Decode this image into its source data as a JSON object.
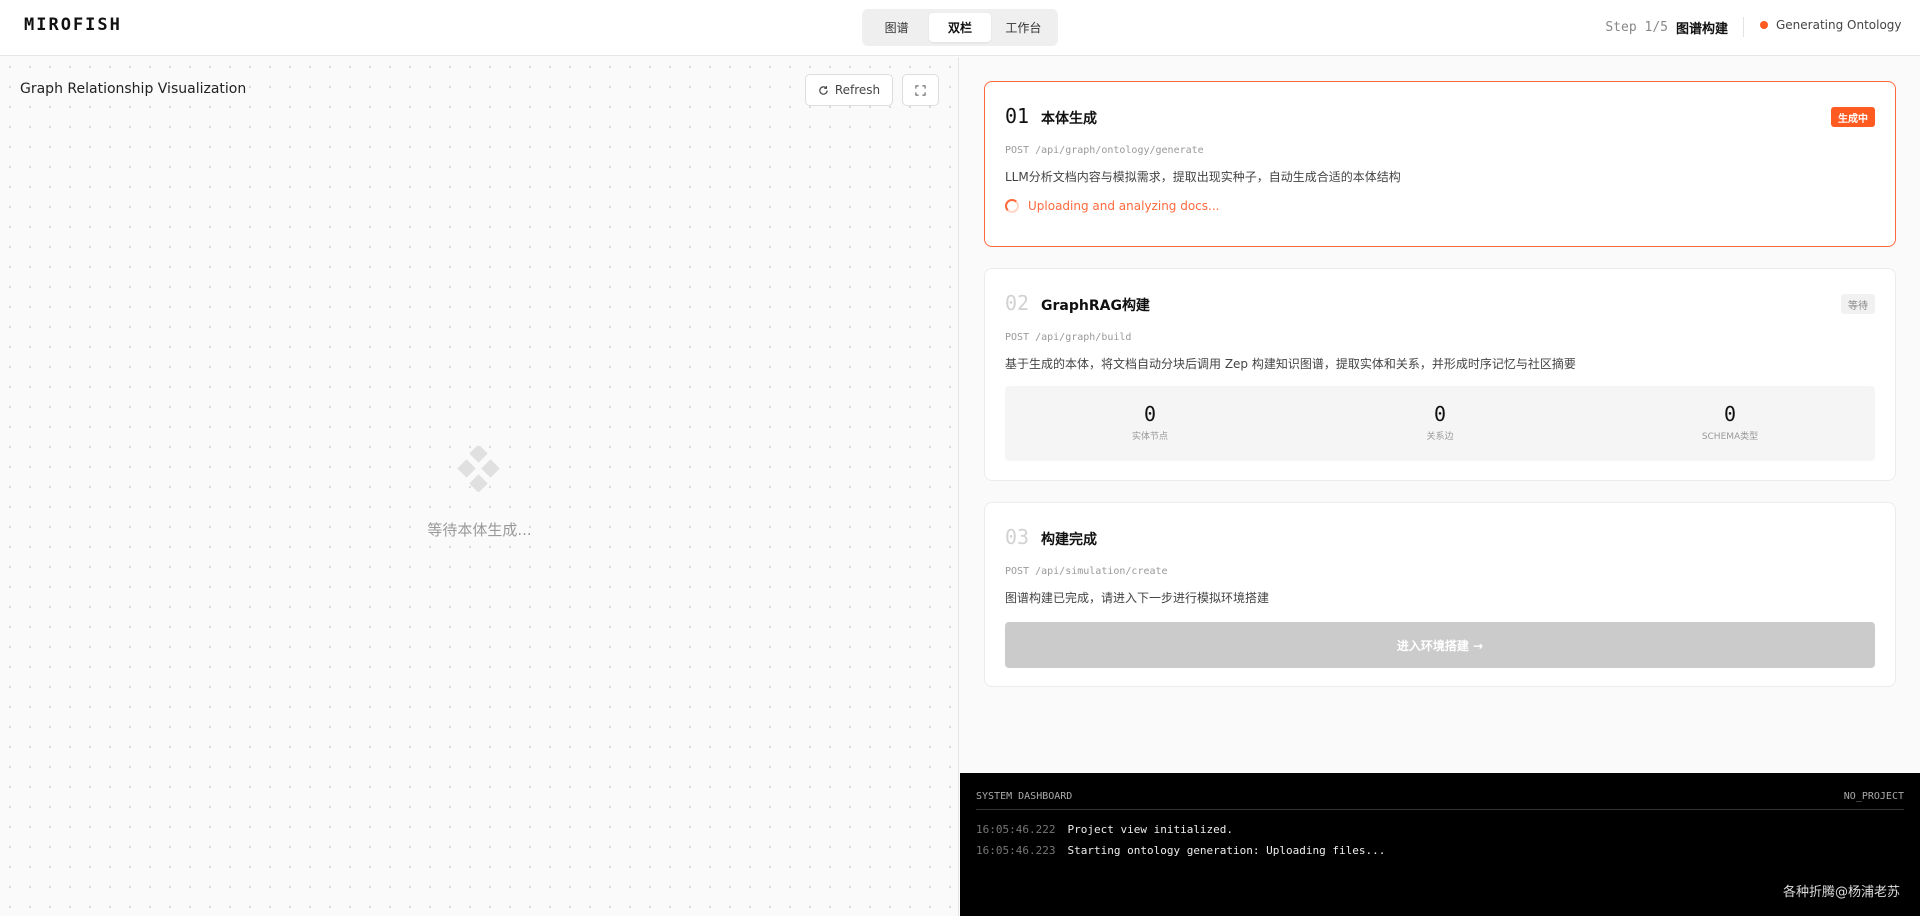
{
  "header": {
    "brand": "MIROFISH",
    "tabs": [
      "图谱",
      "双栏",
      "工作台"
    ],
    "active_tab": "双栏",
    "step_counter": "Step 1/5",
    "step_name": "图谱构建",
    "status": "Generating Ontology",
    "status_color": "#ff5a1f"
  },
  "graph_panel": {
    "title": "Graph Relationship Visualization",
    "refresh_label": "Refresh",
    "empty_text": "等待本体生成..."
  },
  "steps": [
    {
      "num": "01",
      "title": "本体生成",
      "badge": "生成中",
      "api": "POST /api/graph/ontology/generate",
      "desc": "LLM分析文档内容与模拟需求，提取出现实种子，自动生成合适的本体结构",
      "progress": "Uploading and analyzing docs..."
    },
    {
      "num": "02",
      "title": "GraphRAG构建",
      "badge": "等待",
      "api": "POST /api/graph/build",
      "desc": "基于生成的本体，将文档自动分块后调用 Zep 构建知识图谱，提取实体和关系，并形成时序记忆与社区摘要",
      "stats": [
        {
          "value": "0",
          "label": "实体节点"
        },
        {
          "value": "0",
          "label": "关系边"
        },
        {
          "value": "0",
          "label": "SCHEMA类型"
        }
      ]
    },
    {
      "num": "03",
      "title": "构建完成",
      "api": "POST /api/simulation/create",
      "desc": "图谱构建已完成，请进入下一步进行模拟环境搭建",
      "cta": "进入环境搭建 →"
    }
  ],
  "dashboard": {
    "title": "SYSTEM DASHBOARD",
    "project": "NO_PROJECT",
    "logs": [
      {
        "time": "16:05:46.222",
        "msg": "Project view initialized."
      },
      {
        "time": "16:05:46.223",
        "msg": "Starting ontology generation: Uploading files..."
      }
    ],
    "watermark": "各种折腾@杨浦老苏"
  },
  "colors": {
    "accent": "#ff5a1f",
    "disabled": "#cbcbcb"
  }
}
